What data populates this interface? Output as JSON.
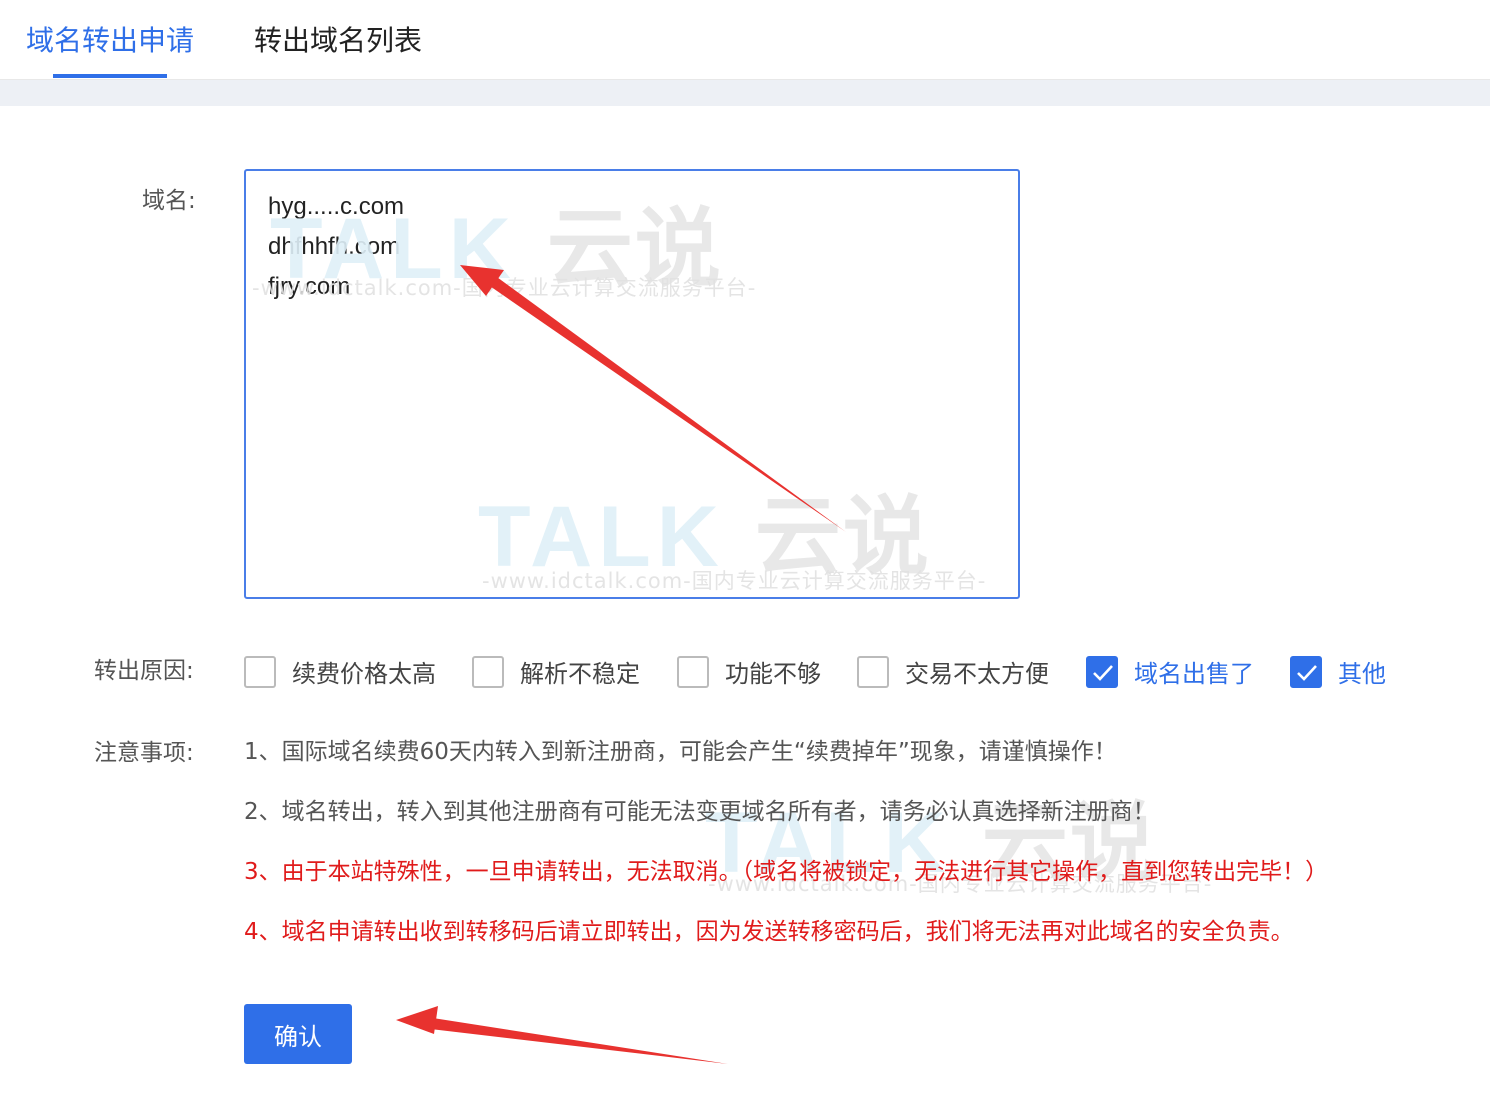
{
  "tabs": [
    {
      "label": "域名转出申请",
      "active": true
    },
    {
      "label": "转出域名列表",
      "active": false
    }
  ],
  "form": {
    "domain_label": "域名:",
    "domains": [
      "hyg.....c.com",
      "dhfhhfh.com",
      "fjry.com"
    ],
    "reason_label": "转出原因:",
    "reasons": [
      {
        "label": "续费价格太高",
        "checked": false
      },
      {
        "label": "解析不稳定",
        "checked": false
      },
      {
        "label": "功能不够",
        "checked": false
      },
      {
        "label": "交易不太方便",
        "checked": false
      },
      {
        "label": "域名出售了",
        "checked": true
      },
      {
        "label": "其他",
        "checked": true
      }
    ],
    "notes_label": "注意事项:",
    "notes": [
      "1、国际域名续费60天内转入到新注册商，可能会产生“续费掉年”现象，请谨慎操作！",
      "2、域名转出，转入到其他注册商有可能无法变更域名所有者，请务必认真选择新注册商！",
      "3、由于本站特殊性，一旦申请转出，无法取消。（域名将被锁定，无法进行其它操作，直到您转出完毕！）",
      "4、域名申请转出收到转移码后请立即转出，因为发送转移密码后，我们将无法再对此域名的安全负责。"
    ],
    "confirm_label": "确认"
  },
  "watermark": {
    "logo_text": "TALK",
    "logo_cn": "云说",
    "subtitle": "-www.idctalk.com-国内专业云计算交流服务平台-"
  },
  "colors": {
    "accent": "#2f6fe8",
    "warning": "#e01b1b",
    "annotation_arrow": "#e8322f"
  }
}
